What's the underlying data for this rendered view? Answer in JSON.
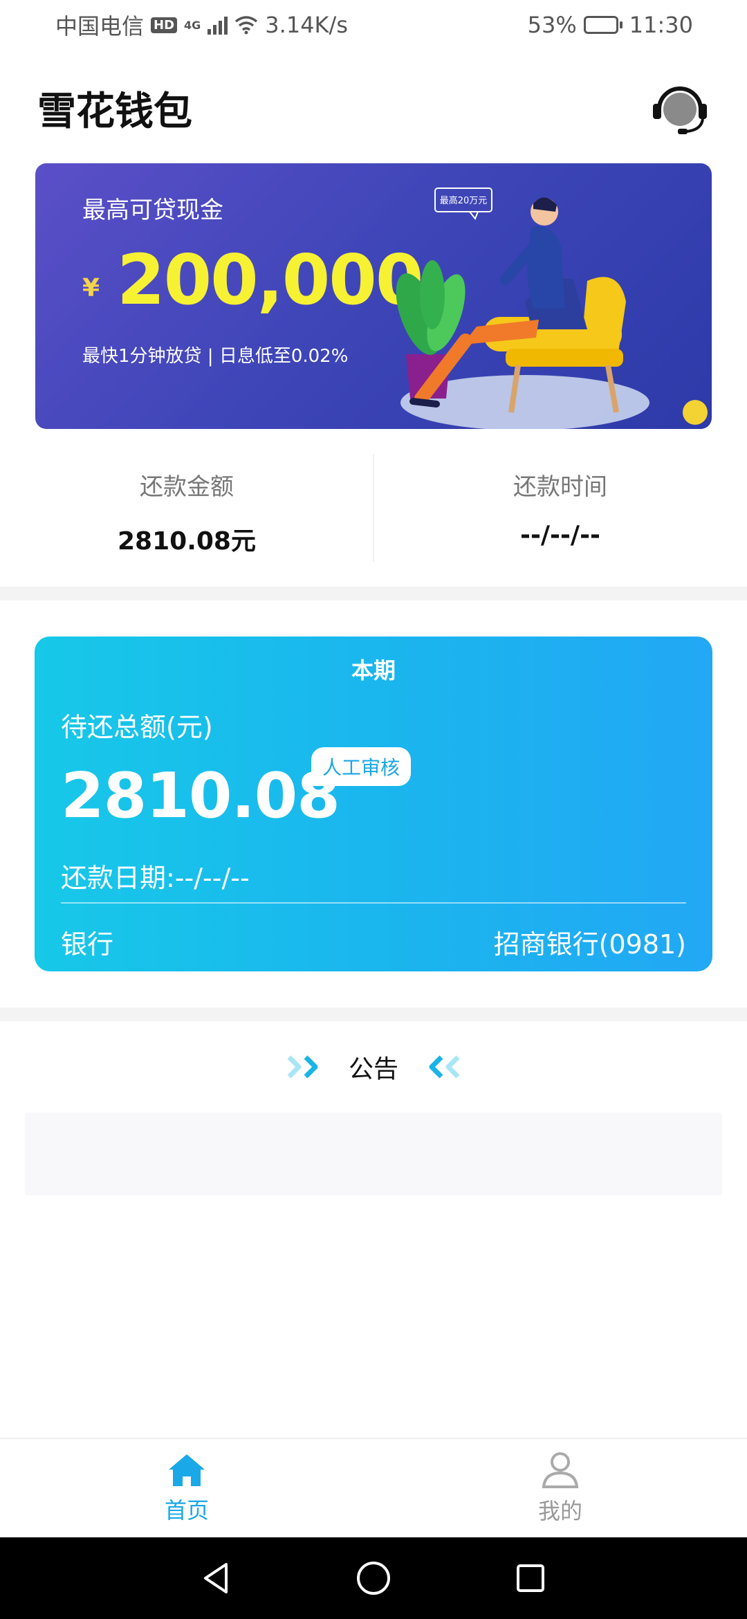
{
  "status_bar": {
    "carrier": "中国电信",
    "hd_label": "HD",
    "network": "4G",
    "speed": "3.14K/s",
    "battery": "53%",
    "battery_level": 0.53,
    "time": "11:30"
  },
  "header": {
    "title": "雪花钱包",
    "support_icon": "customer-service-headset-icon"
  },
  "banner": {
    "subtitle": "最高可贷现金",
    "currency_symbol": "¥",
    "amount": "200,000",
    "footer": "最快1分钟放贷 | 日息低至0.02%",
    "bubble_text": "最高20万元",
    "colors": {
      "bg": "#4146b8",
      "amount": "#f7f134"
    }
  },
  "summary": {
    "amount_label": "还款金额",
    "amount_value": "2810.08元",
    "time_label": "还款时间",
    "time_value": "--/--/--"
  },
  "period_card": {
    "title": "本期",
    "total_label": "待还总额(元)",
    "total_amount": "2810.08",
    "status_badge": "人工审核",
    "due_date": "还款日期:--/--/--",
    "bank_label": "银行",
    "bank_value": "招商银行(0981)",
    "colors": {
      "start": "#17c8e8",
      "end": "#22a8f4"
    }
  },
  "notice": {
    "title": "公告"
  },
  "tabbar": {
    "items": [
      {
        "label": "首页",
        "icon": "home-icon",
        "active": true
      },
      {
        "label": "我的",
        "icon": "user-icon",
        "active": false
      }
    ],
    "accent": "#1aa8e8"
  },
  "system_nav": {
    "back": "back-triangle-icon",
    "home": "home-circle-icon",
    "recents": "recents-square-icon"
  }
}
